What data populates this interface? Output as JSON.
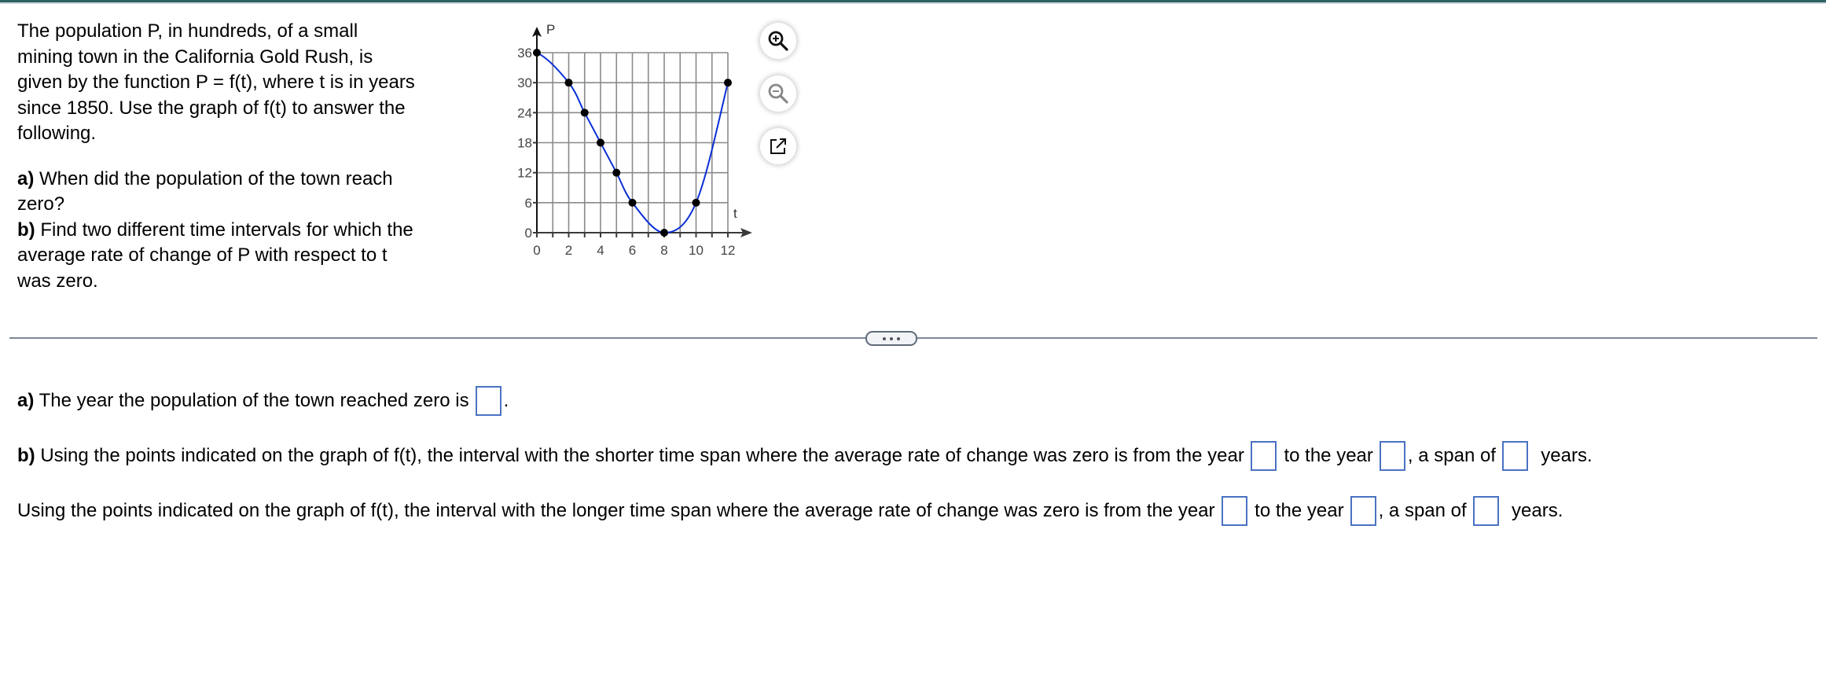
{
  "question": {
    "intro": "The population P, in hundreds, of a small mining town in the California Gold Rush, is given by the function P = f(t), where t is in years since 1850. Use the graph of f(t) to answer the following.",
    "intro_lines": [
      "The population P, in hundreds, of a small",
      "mining town in the California Gold Rush, is",
      "given by the function P = f(t), where t is in years",
      "since 1850. Use the graph of f(t) to answer the",
      "following."
    ],
    "part_a_label": "a)",
    "part_a_lines": [
      " When did the population of the town reach",
      "zero?"
    ],
    "part_b_label": "b)",
    "part_b_lines": [
      " Find two different time intervals for which the",
      "average rate of change of P with respect to t",
      "was zero."
    ]
  },
  "chart_data": {
    "type": "line",
    "title": "",
    "xlabel": "t",
    "ylabel": "P",
    "xlim": [
      0,
      12
    ],
    "ylim": [
      0,
      36
    ],
    "grid": true,
    "x_ticks": [
      0,
      2,
      4,
      6,
      8,
      10,
      12
    ],
    "x_tick_labels": [
      "0",
      "2",
      "4",
      "6",
      "8",
      "10",
      "12"
    ],
    "x_grid_step": 1,
    "y_ticks": [
      0,
      6,
      12,
      18,
      24,
      30,
      36
    ],
    "y_tick_labels": [
      "0",
      "6",
      "12",
      "18",
      "24",
      "30",
      "36"
    ],
    "series": [
      {
        "name": "f(t)",
        "color": "#0a2fd6",
        "marked_points": [
          {
            "t": 0,
            "P": 36
          },
          {
            "t": 2,
            "P": 30
          },
          {
            "t": 3,
            "P": 24
          },
          {
            "t": 4,
            "P": 18
          },
          {
            "t": 5,
            "P": 12
          },
          {
            "t": 6,
            "P": 6
          },
          {
            "t": 8,
            "P": 0
          },
          {
            "t": 10,
            "P": 6
          },
          {
            "t": 12,
            "P": 30
          }
        ]
      }
    ]
  },
  "tools": {
    "zoom_in": "zoom-in",
    "zoom_out": "zoom-out",
    "popout": "open-in-new-window"
  },
  "divider": {
    "more_label": "..."
  },
  "answers": {
    "a_label": "a)",
    "a_text": " The year the population of the town reached zero is",
    "a_end": ".",
    "b_label": "b)",
    "b1_text": " Using the points indicated on the graph of f(t), the interval with the shorter time span where the average rate of change was zero is from the year",
    "b2_text": "Using the points indicated on the graph of f(t), the interval with the longer time span where the average rate of change was zero is from the year",
    "to_the_year": " to the year",
    "a_span_of": ", a span of",
    "years": "  years.",
    "values": {
      "a_year": "",
      "short_from": "",
      "short_to": "",
      "short_span": "",
      "long_from": "",
      "long_to": "",
      "long_span": ""
    }
  }
}
